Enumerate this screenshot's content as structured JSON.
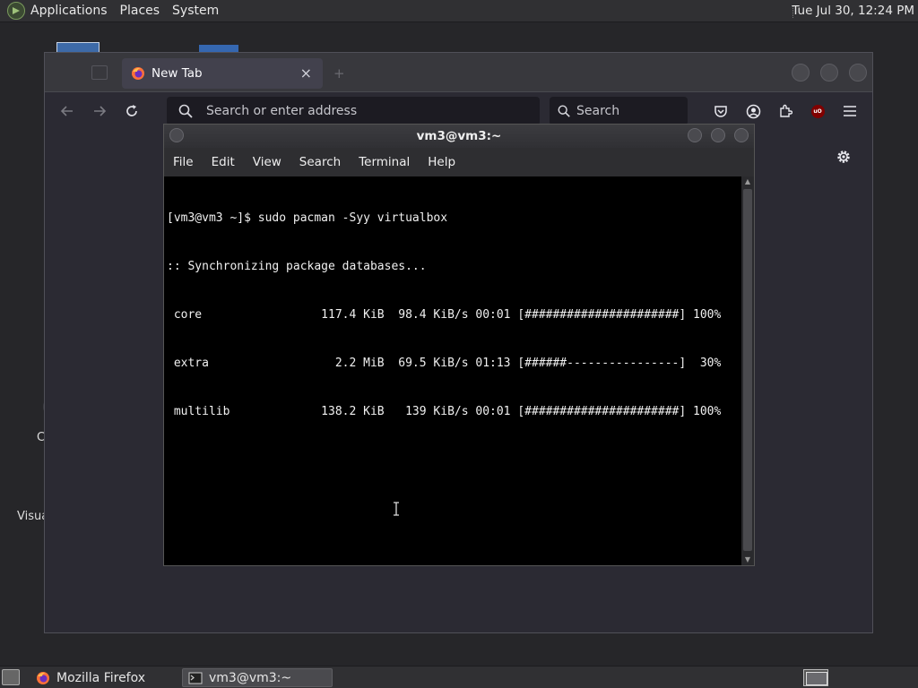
{
  "top_panel": {
    "menus": [
      "Applications",
      "Places",
      "System"
    ],
    "clock": "Tue Jul 30, 12:24 PM"
  },
  "desktop": {
    "partial_labels": [
      "C",
      "Visua"
    ]
  },
  "firefox": {
    "tab_title": "New Tab",
    "tab_close": "×",
    "address_placeholder": "Search or enter address",
    "search_placeholder": "Search",
    "ublock_badge": "uO"
  },
  "terminal": {
    "title": "vm3@vm3:~",
    "menu": [
      "File",
      "Edit",
      "View",
      "Search",
      "Terminal",
      "Help"
    ],
    "lines": [
      "[vm3@vm3 ~]$ sudo pacman -Syy virtualbox",
      ":: Synchronizing package databases...",
      " core                 117.4 KiB  98.4 KiB/s 00:01 [######################] 100%",
      " extra                  2.2 MiB  69.5 KiB/s 01:13 [######----------------]  30%",
      " multilib             138.2 KiB   139 KiB/s 00:01 [######################] 100%"
    ]
  },
  "taskbar": {
    "items": [
      {
        "label": "Mozilla Firefox",
        "icon": "firefox-icon"
      },
      {
        "label": "vm3@vm3:~",
        "icon": "terminal-icon"
      }
    ]
  }
}
